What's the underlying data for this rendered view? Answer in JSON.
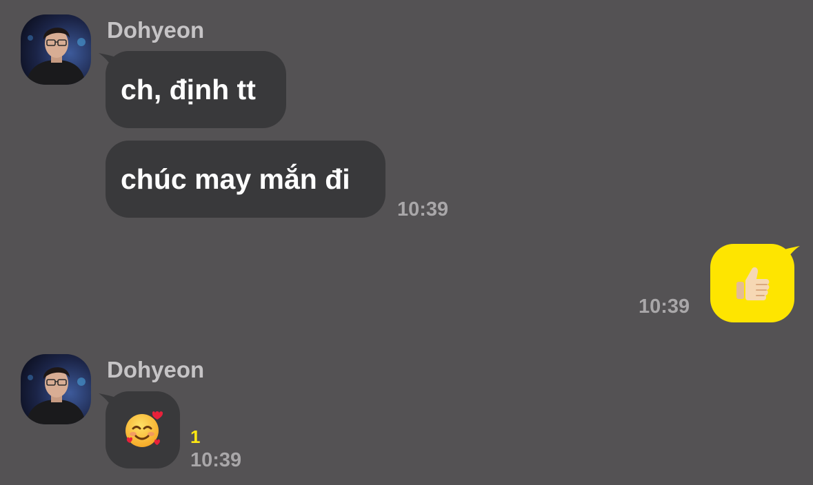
{
  "colors": {
    "background": "#545254",
    "incoming_bubble": "#39393b",
    "outgoing_bubble": "#fee500",
    "unread_count": "#ffe812"
  },
  "groups": [
    {
      "sender": "Dohyeon",
      "avatar": "avatar-photo",
      "messages": [
        "ch, định tt",
        "chúc may mắn đi"
      ],
      "time": "10:39"
    },
    {
      "outgoing": true,
      "message_icon": "thumbs-up-emoji",
      "time": "10:39"
    },
    {
      "sender": "Dohyeon",
      "avatar": "avatar-photo",
      "message_icon": "smiling-face-with-hearts-emoji",
      "unread": "1",
      "time": "10:39"
    }
  ]
}
